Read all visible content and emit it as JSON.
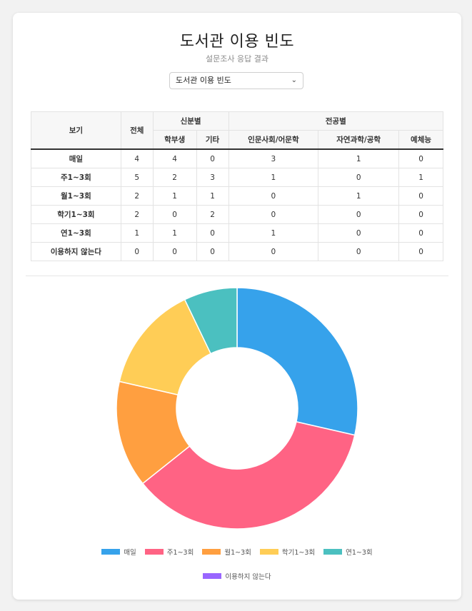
{
  "page": {
    "title": "도서관 이용 빈도",
    "subtitle": "설문조사 응답 결과",
    "select": {
      "value": "도서관 이용 빈도"
    }
  },
  "table": {
    "header": {
      "view": "보기",
      "total": "전체",
      "group_status": "신분별",
      "group_major": "전공별",
      "undergrad": "학부생",
      "other": "기타",
      "humanities": "인문사회/어문학",
      "science": "자연과학/공학",
      "arts": "예체능"
    },
    "rows": [
      {
        "label": "매일",
        "values": [
          "4",
          "4",
          "0",
          "3",
          "1",
          "0"
        ]
      },
      {
        "label": "주1~3회",
        "values": [
          "5",
          "2",
          "3",
          "1",
          "0",
          "1"
        ]
      },
      {
        "label": "월1~3회",
        "values": [
          "2",
          "1",
          "1",
          "0",
          "1",
          "0"
        ]
      },
      {
        "label": "학기1~3회",
        "values": [
          "2",
          "0",
          "2",
          "0",
          "0",
          "0"
        ]
      },
      {
        "label": "연1~3회",
        "values": [
          "1",
          "1",
          "0",
          "1",
          "0",
          "0"
        ]
      },
      {
        "label": "이용하지 않는다",
        "values": [
          "0",
          "0",
          "0",
          "0",
          "0",
          "0"
        ]
      }
    ]
  },
  "chart_data": {
    "type": "pie",
    "categories": [
      "매일",
      "주1~3회",
      "월1~3회",
      "학기1~3회",
      "연1~3회",
      "이용하지 않는다"
    ],
    "values": [
      4,
      5,
      2,
      2,
      1,
      0
    ],
    "colors": [
      "#36a2eb",
      "#ff6384",
      "#ff9f40",
      "#ffcd56",
      "#4bc0c0",
      "#9966ff"
    ],
    "legend_position": "bottom",
    "hole": "donut"
  }
}
